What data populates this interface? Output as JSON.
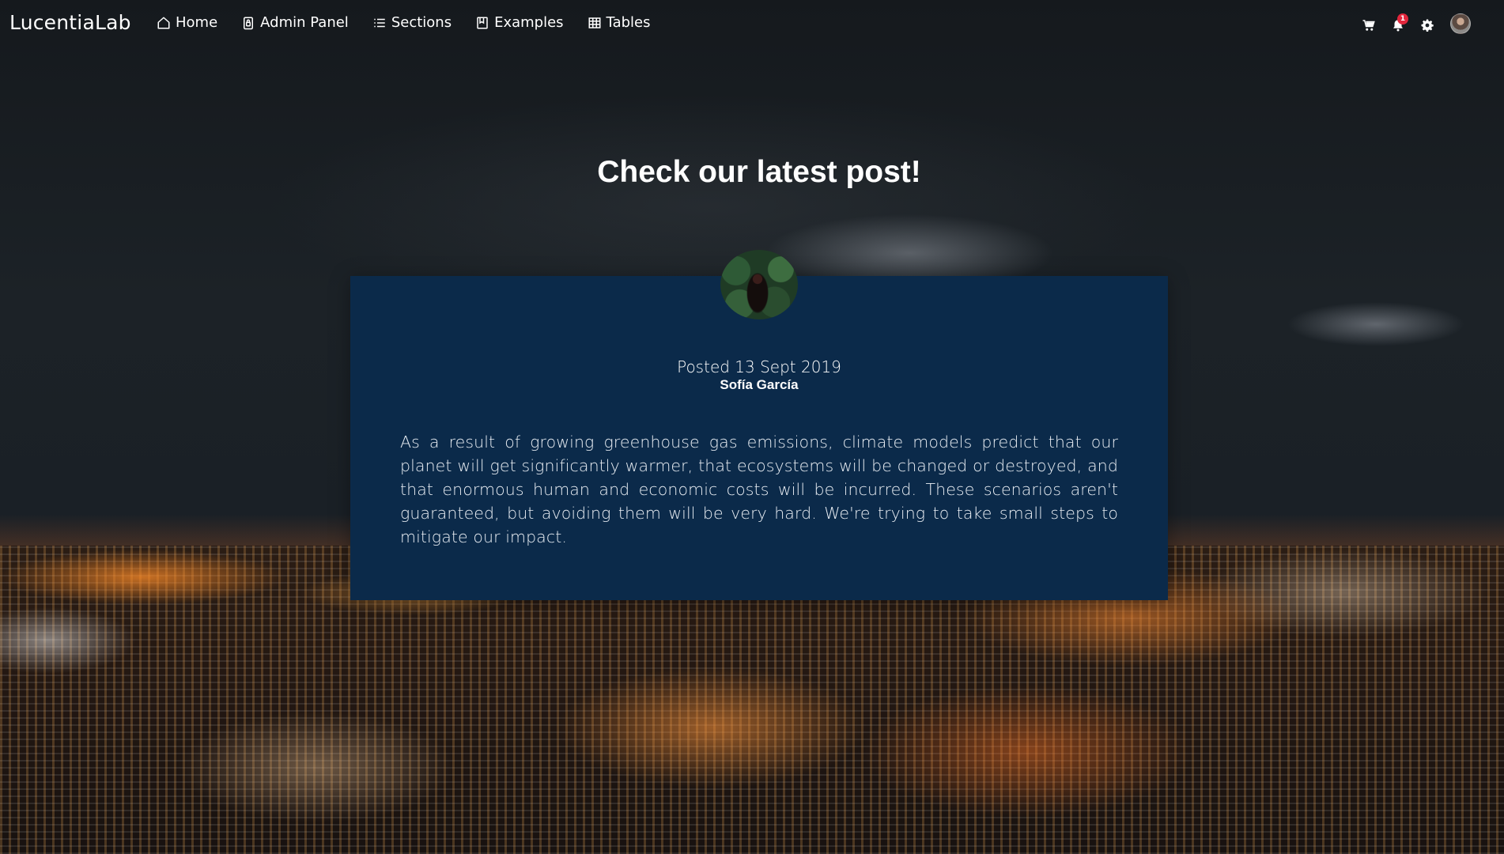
{
  "navbar": {
    "brand": "LucentiaLab",
    "items": [
      {
        "label": "Home",
        "icon": "home-icon"
      },
      {
        "label": "Admin Panel",
        "icon": "lock-icon"
      },
      {
        "label": "Sections",
        "icon": "list-icon"
      },
      {
        "label": "Examples",
        "icon": "book-icon"
      },
      {
        "label": "Tables",
        "icon": "table-icon"
      }
    ],
    "right_icons": [
      "cart-icon",
      "bell-icon",
      "gear-icon",
      "avatar"
    ],
    "notification_count": "1"
  },
  "hero": {
    "title": "Check our latest post!"
  },
  "post": {
    "date": "Posted 13 Sept 2019",
    "author": "Sofía García",
    "body": "As a result of growing greenhouse gas emissions, climate models predict that our planet will get significantly warmer, that ecosystems will be changed or destroyed, and that enormous human and economic costs will be incurred. These scenarios aren't guaranteed, but avoiding them will be very hard. We're trying to take small steps to mitigate our impact."
  },
  "colors": {
    "card_background": "#0b2a4a",
    "badge": "#e3263c",
    "text": "#ffffff"
  }
}
